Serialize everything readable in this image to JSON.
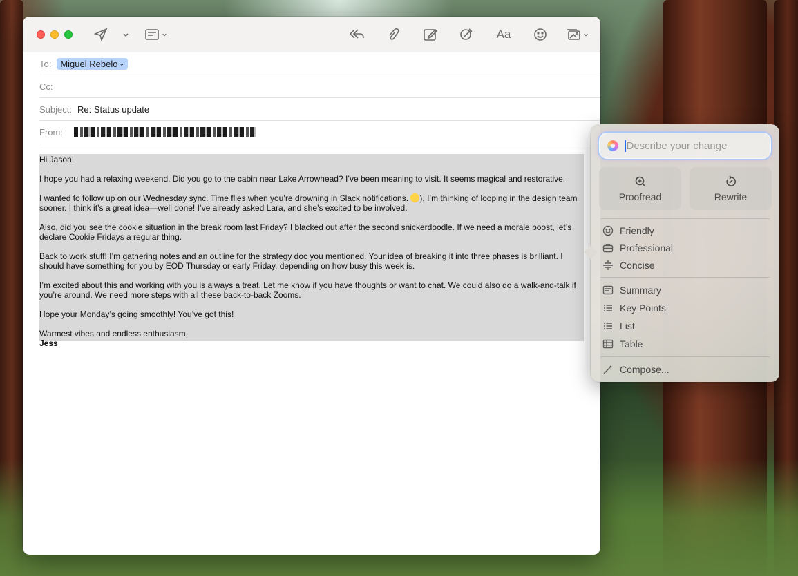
{
  "compose": {
    "to_label": "To:",
    "to_recipient": "Miguel Rebelo",
    "cc_label": "Cc:",
    "subject_label": "Subject:",
    "subject_value": "Re: Status update",
    "from_label": "From:",
    "toolbar": {
      "format_label": "Aa"
    }
  },
  "email_body": {
    "greeting": "Hi Jason!",
    "p1": "I hope you had a relaxing weekend. Did you go to the cabin near Lake Arrowhead? I’ve been meaning to visit. It seems magical and restorative.",
    "p2a": "I wanted to follow up on our Wednesday sync. Time flies when you’re drowning in Slack notifications. ",
    "p2b": "). I’m thinking of looping in the design team sooner. I think it’s a great idea—well done! I’ve already asked Lara, and she’s excited to be involved.",
    "p3": "Also, did you see the cookie situation in the break room last Friday? I blacked out after the second snickerdoodle. If we need a morale boost, let’s declare Cookie Fridays a regular thing.",
    "p4": "Back to work stuff! I’m gathering notes and an outline for the strategy doc you mentioned. Your idea of breaking it into three phases is brilliant. I should have something for you by EOD Thursday or early Friday, depending on how busy this week is.",
    "p5": "I’m excited about this and working with you is always a treat. Let me know if you have thoughts or want to chat. We could also do a walk-and-talk if you’re around. We need more steps with all these back-to-back Zooms.",
    "p6": "Hope your Monday’s going smoothly! You’ve got this!",
    "closing": "Warmest vibes and endless enthusiasm,",
    "signature": "Jess"
  },
  "writing_tools": {
    "input_placeholder": "Describe your change",
    "proofread_label": "Proofread",
    "rewrite_label": "Rewrite",
    "friendly_label": "Friendly",
    "professional_label": "Professional",
    "concise_label": "Concise",
    "summary_label": "Summary",
    "key_points_label": "Key Points",
    "list_label": "List",
    "table_label": "Table",
    "compose_label": "Compose..."
  }
}
